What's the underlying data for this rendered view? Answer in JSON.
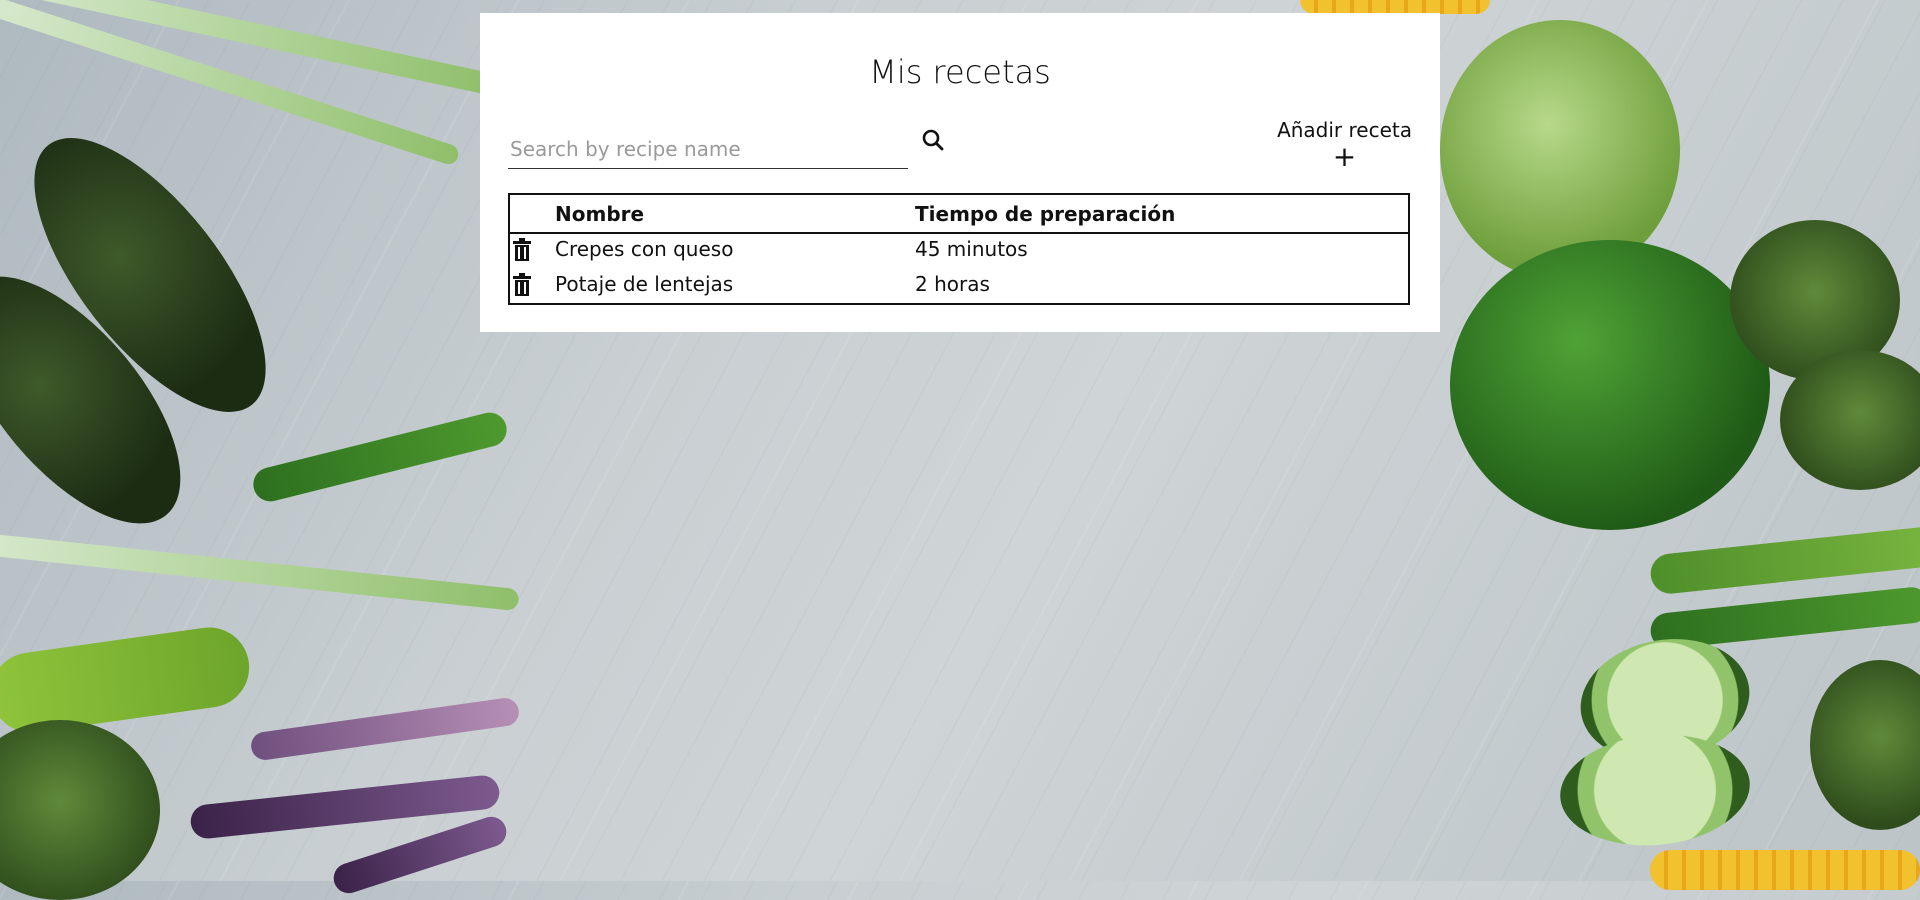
{
  "page": {
    "title": "Mis recetas"
  },
  "search": {
    "placeholder": "Search by recipe name"
  },
  "icons": {
    "search": "search-icon",
    "trash": "trash-icon",
    "add": "plus-icon"
  },
  "add_button": {
    "label": "Añadir receta",
    "plus": "+"
  },
  "table": {
    "headers": [
      "Nombre",
      "Tiempo de preparación"
    ],
    "rows": [
      {
        "name": "Crepes con queso",
        "time": "45 minutos"
      },
      {
        "name": "Potaje de lentejas",
        "time": "2 horas"
      }
    ]
  }
}
